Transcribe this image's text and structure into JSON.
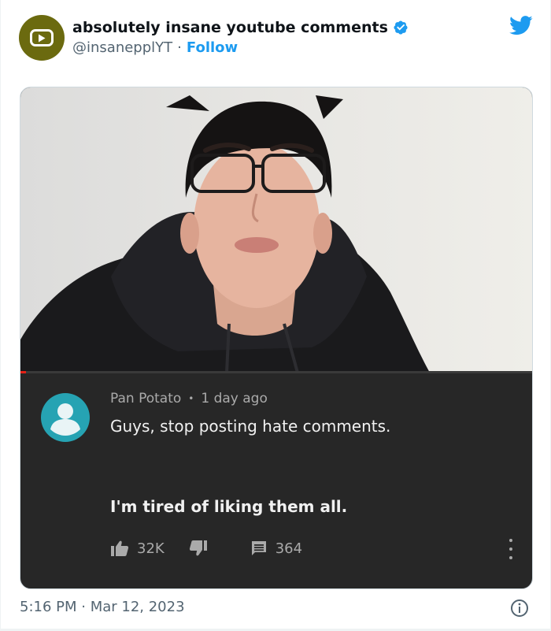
{
  "tweet": {
    "author_name": "absolutely insane youtube comments",
    "handle": "@insanepplYT",
    "separator": "·",
    "follow_label": "Follow",
    "timestamp": "5:16 PM · Mar 12, 2023",
    "colors": {
      "avatar_bg": "#6b6a0f",
      "follow": "#1d9bf0",
      "verified": "#1d9bf0",
      "twitter_logo": "#1d9bf0"
    },
    "icons": {
      "avatar": "youtube-play-icon",
      "verified": "verified-badge-icon",
      "brand": "twitter-bird-icon",
      "info": "info-icon"
    }
  },
  "media": {
    "video": {
      "progress": 0.01,
      "progress_color": "#e62117"
    },
    "comment": {
      "author": "Pan Potato",
      "meta_separator": "•",
      "age": "1 day ago",
      "line1": "Guys, stop posting hate comments.",
      "line2": "I'm tired of liking them all.",
      "likes": "32K",
      "replies": "364",
      "avatar_color": "#26a3b3",
      "background": "#272727",
      "icons": {
        "like": "thumbs-up-icon",
        "dislike": "thumbs-down-icon",
        "reply": "comment-icon",
        "menu": "more-vertical-icon"
      }
    }
  }
}
